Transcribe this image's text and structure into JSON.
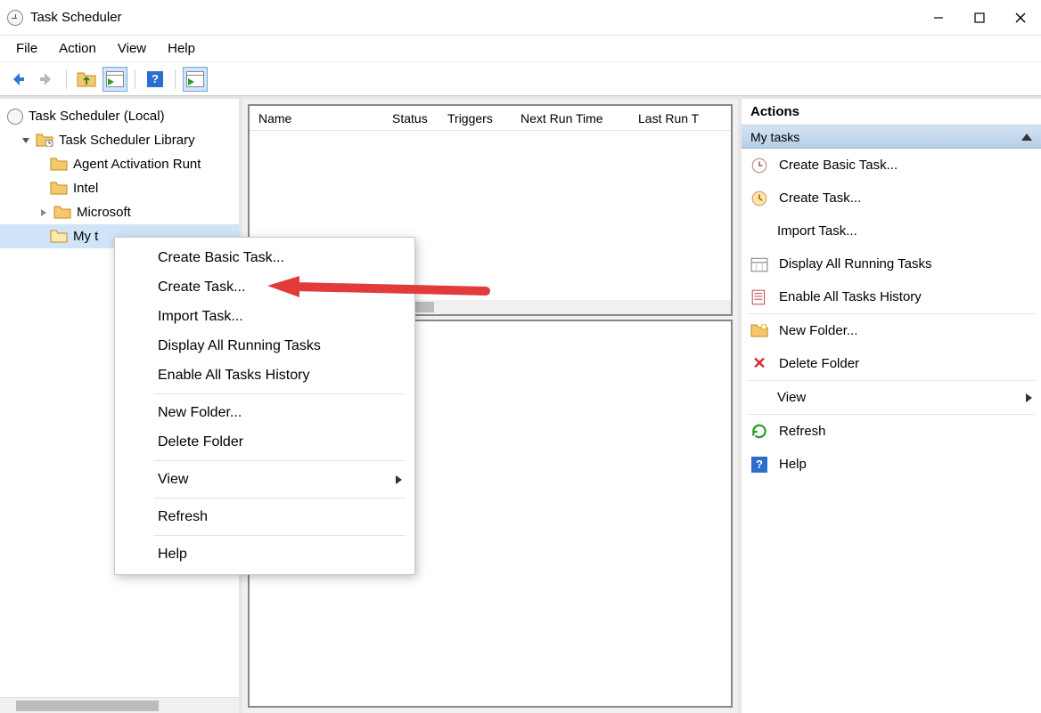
{
  "titlebar": {
    "title": "Task Scheduler"
  },
  "menubar": {
    "items": [
      "File",
      "Action",
      "View",
      "Help"
    ]
  },
  "tree": {
    "root": "Task Scheduler (Local)",
    "library": "Task Scheduler Library",
    "nodes": [
      {
        "label": "Agent Activation Runt",
        "hasChildren": false
      },
      {
        "label": "Intel",
        "hasChildren": false
      },
      {
        "label": "Microsoft",
        "hasChildren": true
      },
      {
        "label": "My tasks",
        "hasChildren": false,
        "selected": true,
        "truncated": "My t"
      }
    ]
  },
  "list": {
    "columns": [
      "Name",
      "Status",
      "Triggers",
      "Next Run Time",
      "Last Run T"
    ]
  },
  "actions": {
    "title": "Actions",
    "band": "My tasks",
    "items": [
      {
        "label": "Create Basic Task...",
        "icon": "clock"
      },
      {
        "label": "Create Task...",
        "icon": "clock2"
      },
      {
        "label": "Import Task...",
        "icon": "none",
        "indent": true
      },
      {
        "label": "Display All Running Tasks",
        "icon": "calendar"
      },
      {
        "label": "Enable All Tasks History",
        "icon": "book"
      },
      {
        "label": "New Folder...",
        "icon": "folder"
      },
      {
        "label": "Delete Folder",
        "icon": "x"
      },
      {
        "label": "View",
        "icon": "none",
        "indent": true,
        "submenu": true
      },
      {
        "label": "Refresh",
        "icon": "refresh"
      },
      {
        "label": "Help",
        "icon": "help"
      }
    ]
  },
  "context_menu": {
    "groups": [
      [
        "Create Basic Task...",
        "Create Task...",
        "Import Task...",
        "Display All Running Tasks",
        "Enable All Tasks History"
      ],
      [
        "New Folder...",
        "Delete Folder"
      ],
      [
        "View"
      ],
      [
        "Refresh"
      ],
      [
        "Help"
      ]
    ],
    "submenu_item": "View"
  }
}
